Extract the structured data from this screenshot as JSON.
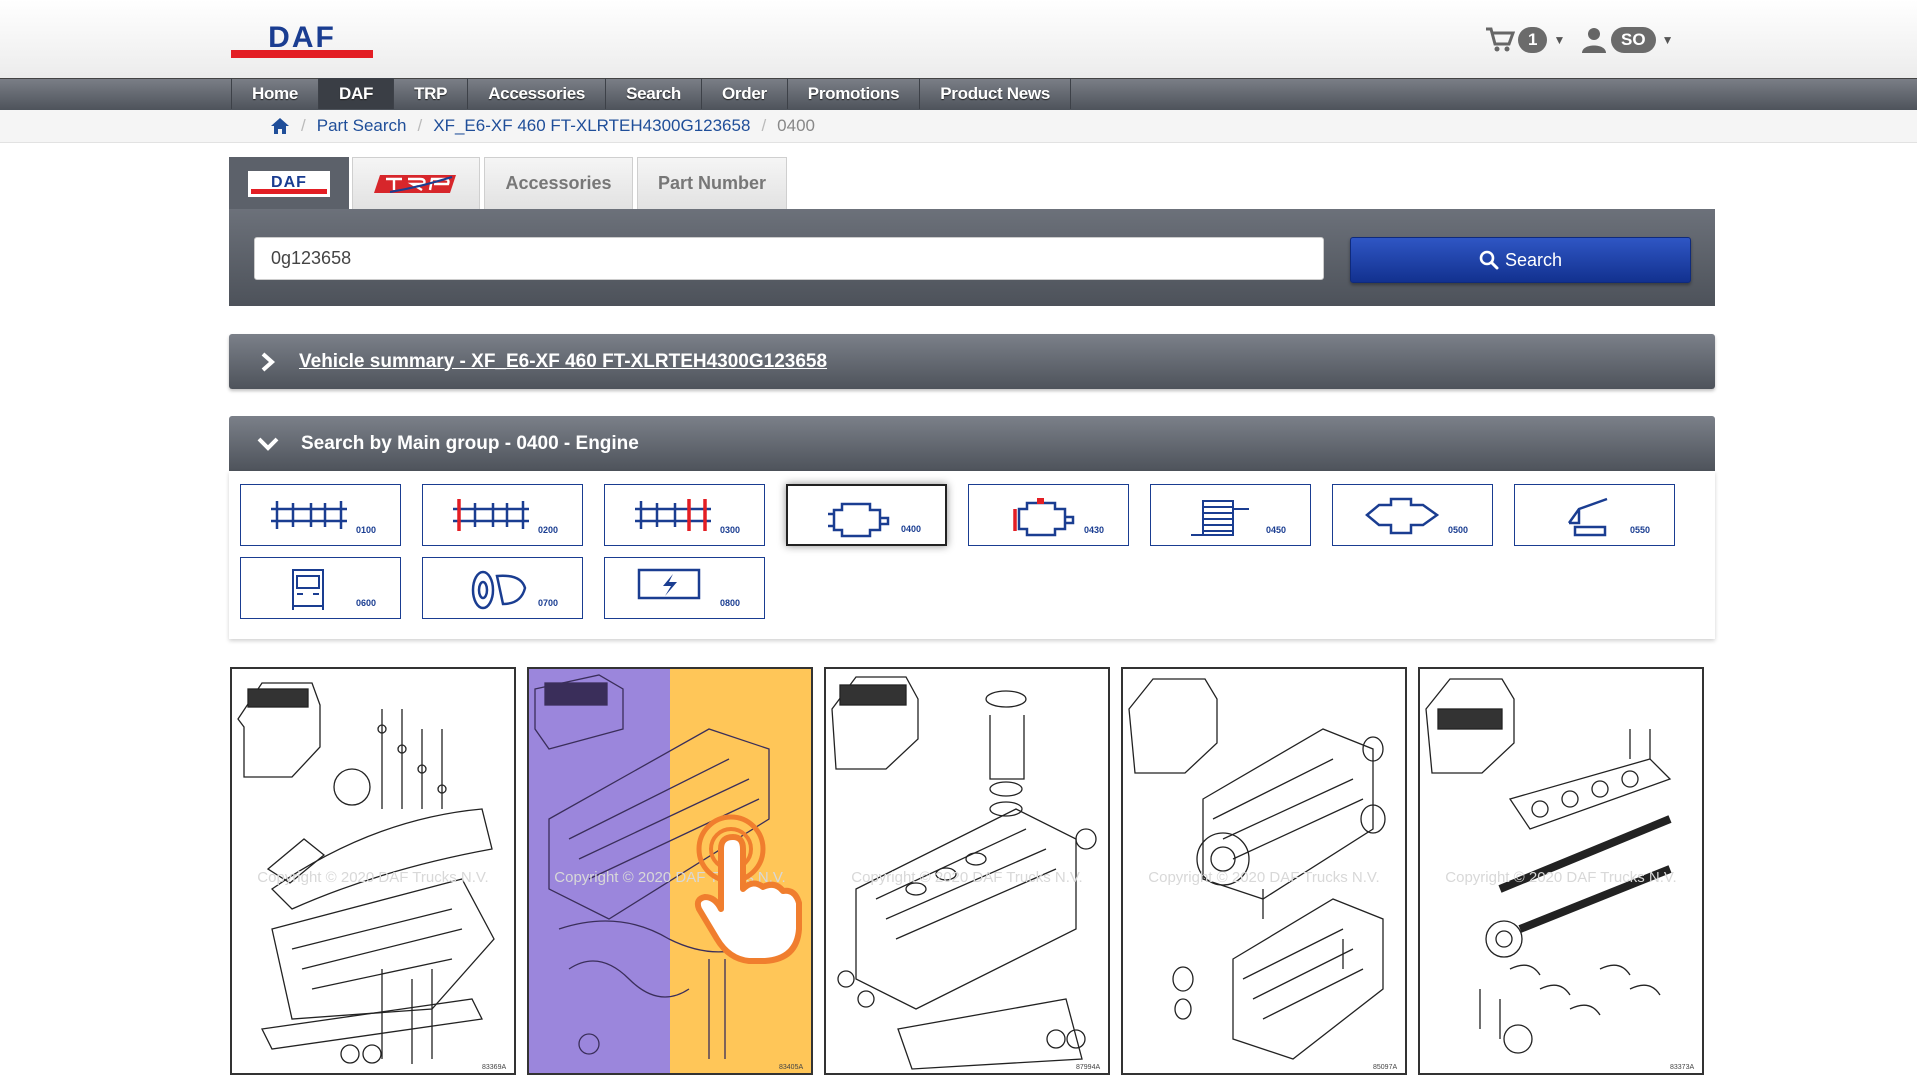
{
  "header": {
    "cart_count": "1",
    "user_initials": "SO"
  },
  "nav": {
    "items": [
      "Home",
      "DAF",
      "TRP",
      "Accessories",
      "Search",
      "Order",
      "Promotions",
      "Product News"
    ],
    "active": "DAF"
  },
  "breadcrumb": {
    "items": [
      "Part Search",
      "XF_E6-XF 460 FT-XLRTEH4300G123658"
    ],
    "current": "0400"
  },
  "search": {
    "tabs": {
      "accessories": "Accessories",
      "part_number": "Part Number"
    },
    "input_value": "0g123658",
    "button_label": "Search"
  },
  "vehicle_summary": {
    "title": "Vehicle summary - XF_E6-XF 460 FT-XLRTEH4300G123658"
  },
  "main_group": {
    "title": "Search by Main group - 0400 - Engine",
    "groups": [
      {
        "code": "0100"
      },
      {
        "code": "0200"
      },
      {
        "code": "0300"
      },
      {
        "code": "0400"
      },
      {
        "code": "0430"
      },
      {
        "code": "0450"
      },
      {
        "code": "0500"
      },
      {
        "code": "0550"
      },
      {
        "code": "0600"
      },
      {
        "code": "0700"
      },
      {
        "code": "0800"
      }
    ]
  },
  "diagrams": [
    {
      "code": "83369A",
      "watermark": "Copyright © 2020 DAF Trucks N.V."
    },
    {
      "code": "83405A",
      "watermark": "Copyright © 2020 DAF Trucks N.V."
    },
    {
      "code": "87994A",
      "watermark": "Copyright © 2020 DAF Trucks N.V."
    },
    {
      "code": "85097A",
      "watermark": "Copyright © 2020 DAF Trucks N.V."
    },
    {
      "code": "83373A",
      "watermark": "Copyright © 2020 DAF Trucks N.V."
    }
  ],
  "colors": {
    "brand_blue": "#1a3d91",
    "brand_red": "#e31e24",
    "button_blue": "#1e40b0",
    "highlight_purple": "#9b86dc",
    "highlight_orange": "#ffc658",
    "pointer_orange": "#f07e2e"
  }
}
